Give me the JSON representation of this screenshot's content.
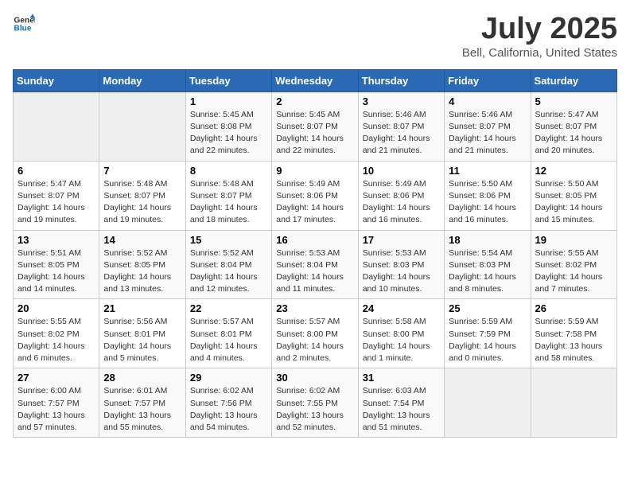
{
  "logo": {
    "general": "General",
    "blue": "Blue"
  },
  "title": "July 2025",
  "subtitle": "Bell, California, United States",
  "calendar": {
    "headers": [
      "Sunday",
      "Monday",
      "Tuesday",
      "Wednesday",
      "Thursday",
      "Friday",
      "Saturday"
    ],
    "weeks": [
      [
        {
          "day": "",
          "info": "",
          "empty": true
        },
        {
          "day": "",
          "info": "",
          "empty": true
        },
        {
          "day": "1",
          "info": "Sunrise: 5:45 AM\nSunset: 8:08 PM\nDaylight: 14 hours\nand 22 minutes."
        },
        {
          "day": "2",
          "info": "Sunrise: 5:45 AM\nSunset: 8:07 PM\nDaylight: 14 hours\nand 22 minutes."
        },
        {
          "day": "3",
          "info": "Sunrise: 5:46 AM\nSunset: 8:07 PM\nDaylight: 14 hours\nand 21 minutes."
        },
        {
          "day": "4",
          "info": "Sunrise: 5:46 AM\nSunset: 8:07 PM\nDaylight: 14 hours\nand 21 minutes."
        },
        {
          "day": "5",
          "info": "Sunrise: 5:47 AM\nSunset: 8:07 PM\nDaylight: 14 hours\nand 20 minutes."
        }
      ],
      [
        {
          "day": "6",
          "info": "Sunrise: 5:47 AM\nSunset: 8:07 PM\nDaylight: 14 hours\nand 19 minutes."
        },
        {
          "day": "7",
          "info": "Sunrise: 5:48 AM\nSunset: 8:07 PM\nDaylight: 14 hours\nand 19 minutes."
        },
        {
          "day": "8",
          "info": "Sunrise: 5:48 AM\nSunset: 8:07 PM\nDaylight: 14 hours\nand 18 minutes."
        },
        {
          "day": "9",
          "info": "Sunrise: 5:49 AM\nSunset: 8:06 PM\nDaylight: 14 hours\nand 17 minutes."
        },
        {
          "day": "10",
          "info": "Sunrise: 5:49 AM\nSunset: 8:06 PM\nDaylight: 14 hours\nand 16 minutes."
        },
        {
          "day": "11",
          "info": "Sunrise: 5:50 AM\nSunset: 8:06 PM\nDaylight: 14 hours\nand 16 minutes."
        },
        {
          "day": "12",
          "info": "Sunrise: 5:50 AM\nSunset: 8:05 PM\nDaylight: 14 hours\nand 15 minutes."
        }
      ],
      [
        {
          "day": "13",
          "info": "Sunrise: 5:51 AM\nSunset: 8:05 PM\nDaylight: 14 hours\nand 14 minutes."
        },
        {
          "day": "14",
          "info": "Sunrise: 5:52 AM\nSunset: 8:05 PM\nDaylight: 14 hours\nand 13 minutes."
        },
        {
          "day": "15",
          "info": "Sunrise: 5:52 AM\nSunset: 8:04 PM\nDaylight: 14 hours\nand 12 minutes."
        },
        {
          "day": "16",
          "info": "Sunrise: 5:53 AM\nSunset: 8:04 PM\nDaylight: 14 hours\nand 11 minutes."
        },
        {
          "day": "17",
          "info": "Sunrise: 5:53 AM\nSunset: 8:03 PM\nDaylight: 14 hours\nand 10 minutes."
        },
        {
          "day": "18",
          "info": "Sunrise: 5:54 AM\nSunset: 8:03 PM\nDaylight: 14 hours\nand 8 minutes."
        },
        {
          "day": "19",
          "info": "Sunrise: 5:55 AM\nSunset: 8:02 PM\nDaylight: 14 hours\nand 7 minutes."
        }
      ],
      [
        {
          "day": "20",
          "info": "Sunrise: 5:55 AM\nSunset: 8:02 PM\nDaylight: 14 hours\nand 6 minutes."
        },
        {
          "day": "21",
          "info": "Sunrise: 5:56 AM\nSunset: 8:01 PM\nDaylight: 14 hours\nand 5 minutes."
        },
        {
          "day": "22",
          "info": "Sunrise: 5:57 AM\nSunset: 8:01 PM\nDaylight: 14 hours\nand 4 minutes."
        },
        {
          "day": "23",
          "info": "Sunrise: 5:57 AM\nSunset: 8:00 PM\nDaylight: 14 hours\nand 2 minutes."
        },
        {
          "day": "24",
          "info": "Sunrise: 5:58 AM\nSunset: 8:00 PM\nDaylight: 14 hours\nand 1 minute."
        },
        {
          "day": "25",
          "info": "Sunrise: 5:59 AM\nSunset: 7:59 PM\nDaylight: 14 hours\nand 0 minutes."
        },
        {
          "day": "26",
          "info": "Sunrise: 5:59 AM\nSunset: 7:58 PM\nDaylight: 13 hours\nand 58 minutes."
        }
      ],
      [
        {
          "day": "27",
          "info": "Sunrise: 6:00 AM\nSunset: 7:57 PM\nDaylight: 13 hours\nand 57 minutes."
        },
        {
          "day": "28",
          "info": "Sunrise: 6:01 AM\nSunset: 7:57 PM\nDaylight: 13 hours\nand 55 minutes."
        },
        {
          "day": "29",
          "info": "Sunrise: 6:02 AM\nSunset: 7:56 PM\nDaylight: 13 hours\nand 54 minutes."
        },
        {
          "day": "30",
          "info": "Sunrise: 6:02 AM\nSunset: 7:55 PM\nDaylight: 13 hours\nand 52 minutes."
        },
        {
          "day": "31",
          "info": "Sunrise: 6:03 AM\nSunset: 7:54 PM\nDaylight: 13 hours\nand 51 minutes."
        },
        {
          "day": "",
          "info": "",
          "empty": true
        },
        {
          "day": "",
          "info": "",
          "empty": true
        }
      ]
    ]
  }
}
